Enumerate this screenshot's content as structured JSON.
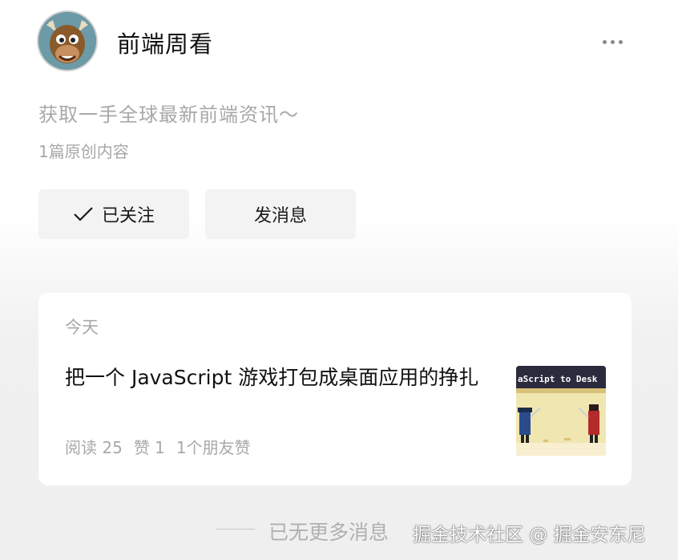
{
  "profile": {
    "name": "前端周看",
    "description": "获取一手全球最新前端资讯～",
    "stats": "1篇原创内容",
    "avatar_icon": "cartoon-moose-avatar"
  },
  "actions": {
    "follow_label": "已关注",
    "follow_icon": "checkmark-icon",
    "message_label": "发消息",
    "more_icon": "more-dots-icon"
  },
  "articles": [
    {
      "date": "今天",
      "title": "把一个 JavaScript 游戏打包成桌面应用的挣扎",
      "read": "阅读 25",
      "like": "赞 1",
      "friends": "1个朋友赞",
      "thumbnail_text": "aScript to Desk"
    }
  ],
  "footer": {
    "end_text": "已无更多消息"
  },
  "watermark": "掘金技术社区 @ 掘金安东尼"
}
